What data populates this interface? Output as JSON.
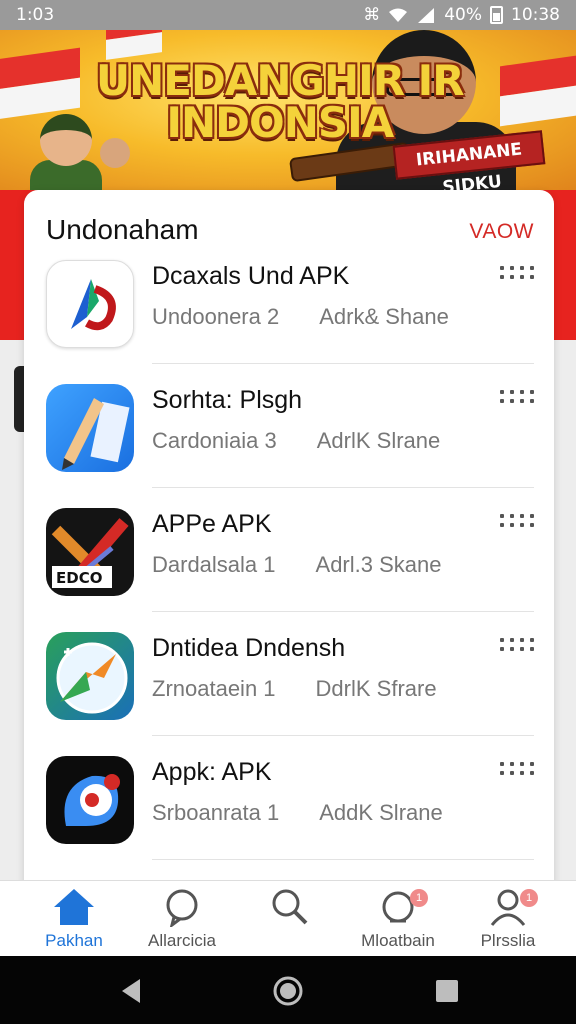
{
  "status_bar": {
    "time": "1:03",
    "battery": "40%",
    "clock": "10:38"
  },
  "banner": {
    "headline_line1": "UNEDANGHIR IR",
    "headline_line2": "INDONSIA",
    "sign_text": "IRIHANANE SIDKU",
    "colors": {
      "flag_red": "#e5312c",
      "gold": "#f4d23a"
    }
  },
  "card": {
    "title": "Undonaham",
    "view_link": "VAOW",
    "apps": [
      {
        "name": "Dcaxals Und APK",
        "category": "Undoonera 2",
        "action": "Adrk& Shane",
        "icon": "red-arrow-logo-icon"
      },
      {
        "name": "Sorhta: Plsgh",
        "category": "Cardoniaia 3",
        "action": "AdrlK Slrane",
        "icon": "pen-ruler-icon"
      },
      {
        "name": "APPe APK",
        "category": "Dardalsala 1",
        "action": "Adrl.3 Skane",
        "icon": "edco-x-icon"
      },
      {
        "name": "Dntidea Dndensh",
        "category": "Zrnoataein 1",
        "action": "DdrlK Sfrare",
        "icon": "compass-map-icon"
      },
      {
        "name": "Appk: APK",
        "category": "Srboanrata 1",
        "action": "AddK Slrane",
        "icon": "blue-bird-icon"
      }
    ]
  },
  "bottom_nav": [
    {
      "label": "Pakhan",
      "icon": "home-icon",
      "active": true
    },
    {
      "label": "Allarcicia",
      "icon": "chat-bubble-icon",
      "active": false
    },
    {
      "label": "",
      "icon": "search-icon",
      "active": false
    },
    {
      "label": "Mloatbain",
      "icon": "notification-icon",
      "active": false,
      "badge": "1"
    },
    {
      "label": "Plrsslia",
      "icon": "profile-icon",
      "active": false,
      "badge": "1"
    }
  ],
  "colors": {
    "accent_red": "#d42a26",
    "active_blue": "#1f74d8"
  }
}
